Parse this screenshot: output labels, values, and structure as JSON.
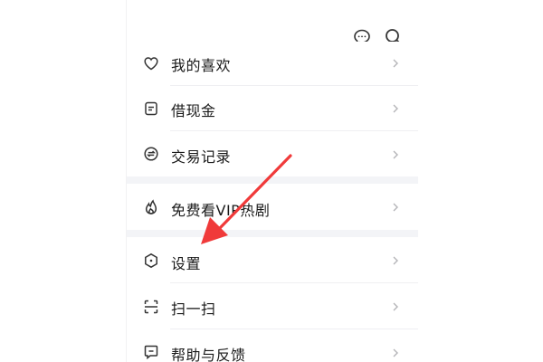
{
  "header": {
    "message_icon": "chat-bubble-icon",
    "search_icon": "search-icon"
  },
  "menu": {
    "items": [
      {
        "label": "我的喜欢",
        "icon": "heart-icon"
      },
      {
        "label": "借现金",
        "icon": "note-icon"
      },
      {
        "label": "交易记录",
        "icon": "exchange-icon"
      },
      {
        "label": "免费看VIP热剧",
        "icon": "flame-icon"
      },
      {
        "label": "设置",
        "icon": "settings-hexagon-icon"
      },
      {
        "label": "扫一扫",
        "icon": "scan-icon"
      },
      {
        "label": "帮助与反馈",
        "icon": "feedback-icon"
      }
    ]
  },
  "colors": {
    "annotation_arrow": "#f03a3a",
    "section_gap": "#f3f4f7",
    "text": "#1a1a1a",
    "chevron": "#b4b4b8"
  }
}
